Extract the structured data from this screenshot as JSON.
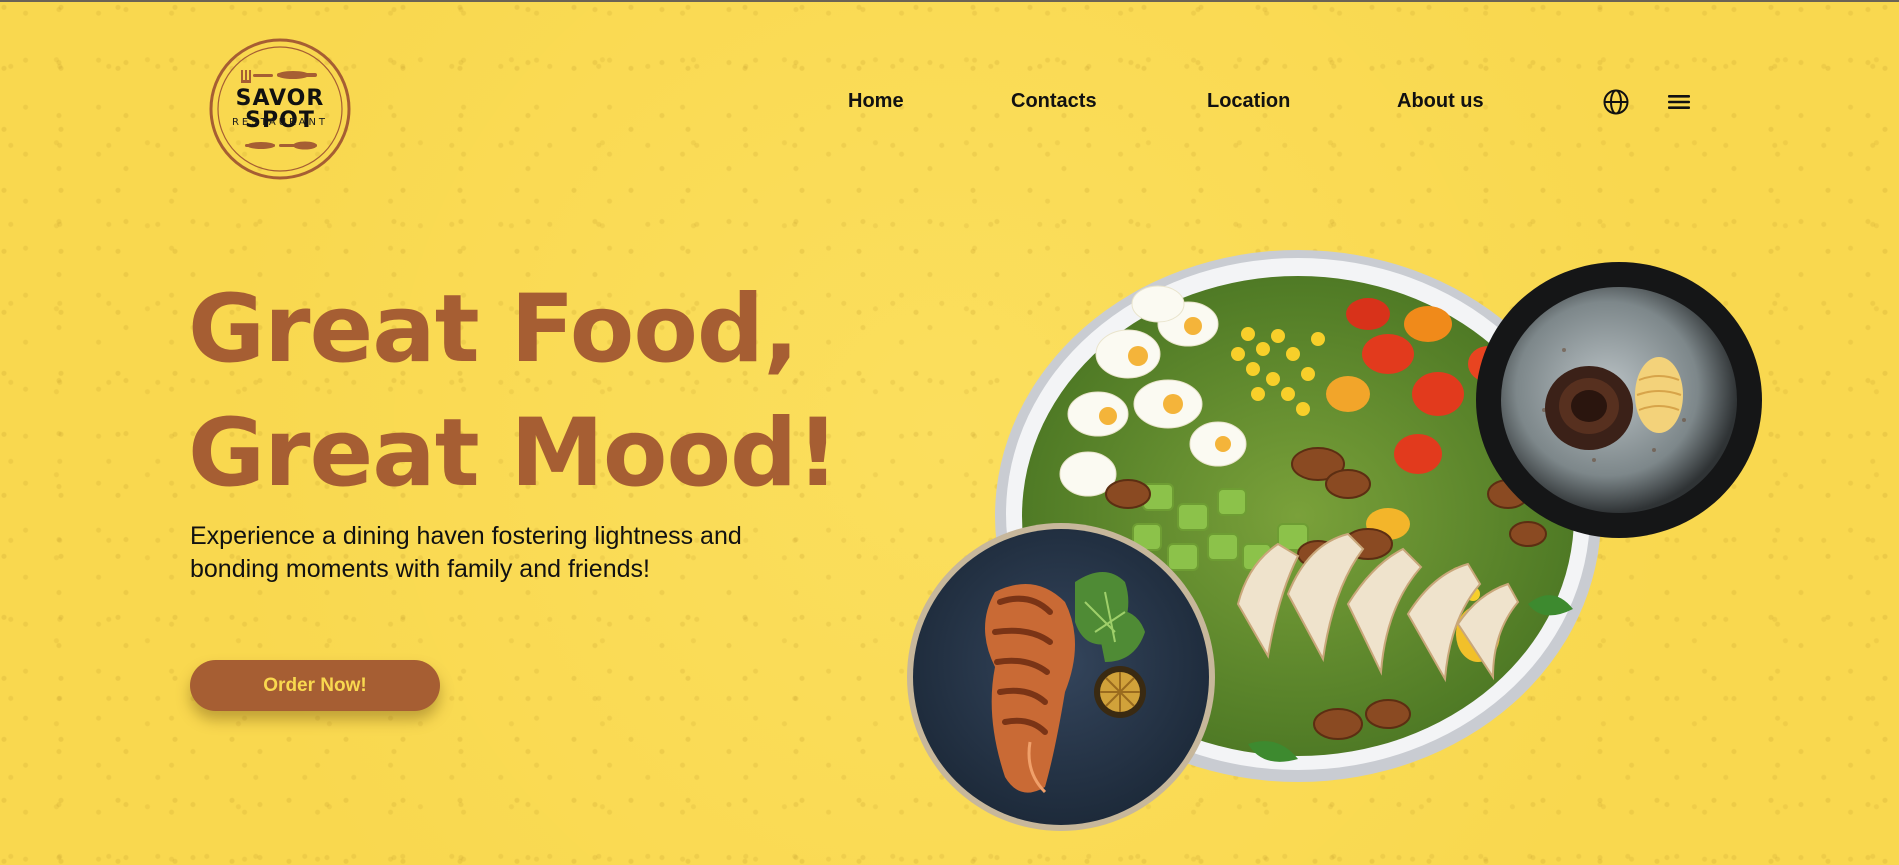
{
  "brand": {
    "logo_title": "SAVOR SPOT",
    "logo_subtitle": "RESTAURANT"
  },
  "nav": {
    "items": [
      {
        "label": "Home"
      },
      {
        "label": "Contacts"
      },
      {
        "label": "Location"
      },
      {
        "label": "About us"
      }
    ],
    "icons": [
      "globe-icon",
      "menu-icon"
    ]
  },
  "hero": {
    "title_line1": "Great Food,",
    "title_line2": "Great Mood!",
    "subtitle": "Experience a dining haven fostering lightness and bonding moments with family and friends!",
    "cta_label": "Order Now!"
  },
  "images": [
    "salad-bowl-image",
    "dessert-plate-image",
    "salmon-plate-image"
  ],
  "colors": {
    "background": "#f9d84f",
    "accent": "#a65e33",
    "text": "#111111"
  }
}
